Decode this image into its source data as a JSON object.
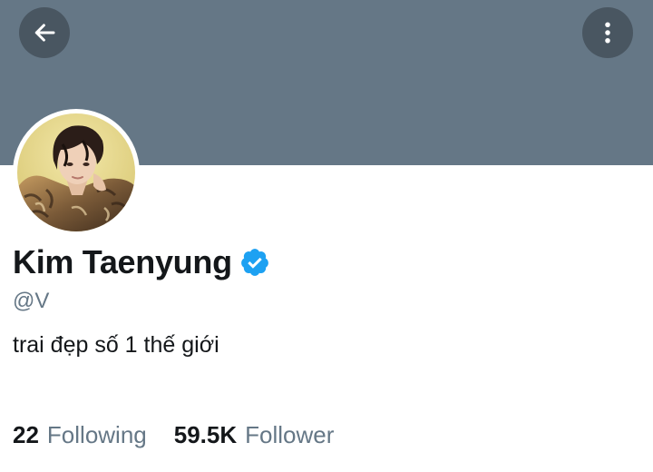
{
  "colors": {
    "banner": "#657786",
    "text_primary": "#14171a",
    "text_secondary": "#657786",
    "verified": "#1da1f2"
  },
  "header": {
    "back_icon": "arrow-left-icon",
    "more_icon": "more-vertical-icon"
  },
  "profile": {
    "display_name": "Kim Taenyung",
    "verified": true,
    "handle": "@V",
    "bio": "trai đẹp số 1 thế giới",
    "avatar_icon": "profile-photo"
  },
  "stats": {
    "following_count": "22",
    "following_label": "Following",
    "follower_count": "59.5K",
    "follower_label": "Follower"
  }
}
